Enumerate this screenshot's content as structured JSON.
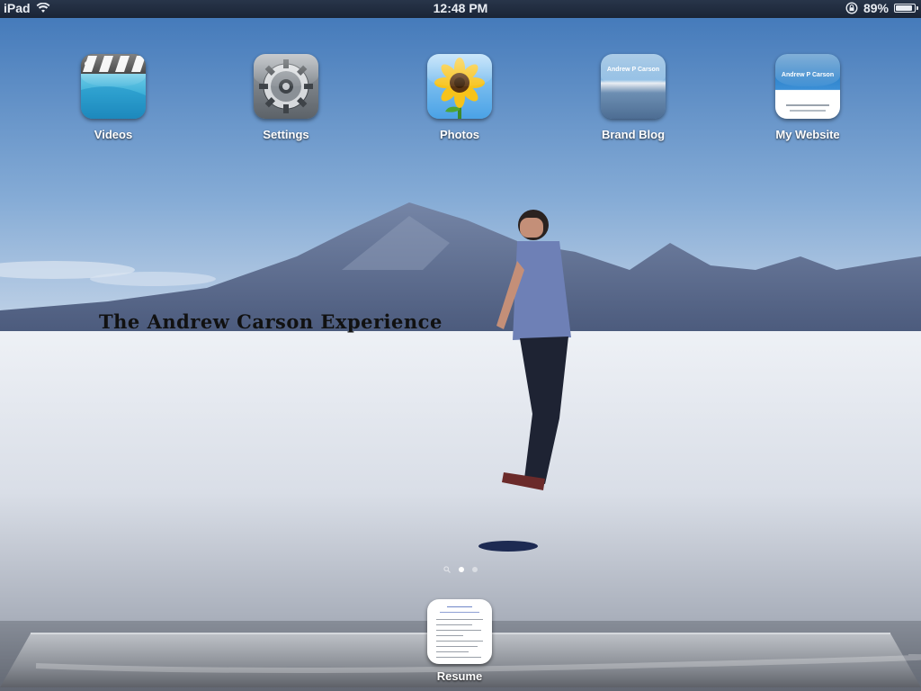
{
  "status_bar": {
    "device": "iPad",
    "time": "12:48 PM",
    "battery": "89%",
    "battery_level": 0.89
  },
  "apps": [
    {
      "label": "Videos",
      "icon": "videos-icon"
    },
    {
      "label": "Settings",
      "icon": "settings-icon"
    },
    {
      "label": "Photos",
      "icon": "photos-icon"
    },
    {
      "label": "Brand Blog",
      "icon": "brand-blog-icon",
      "thumb_text": "Andrew P Carson"
    },
    {
      "label": "My Website",
      "icon": "my-website-icon",
      "thumb_text": "Andrew P Carson"
    }
  ],
  "wallpaper": {
    "title": "The Andrew Carson Experience"
  },
  "page_indicator": {
    "pages": 2,
    "current": 1
  },
  "dock": {
    "apps": [
      {
        "label": "Resume",
        "icon": "resume-icon"
      }
    ]
  },
  "colors": {
    "status_bar": "#1f2a3c",
    "sky": "#5b8fc9",
    "salt_flat": "#dfe5ee",
    "label": "#ffffff"
  }
}
